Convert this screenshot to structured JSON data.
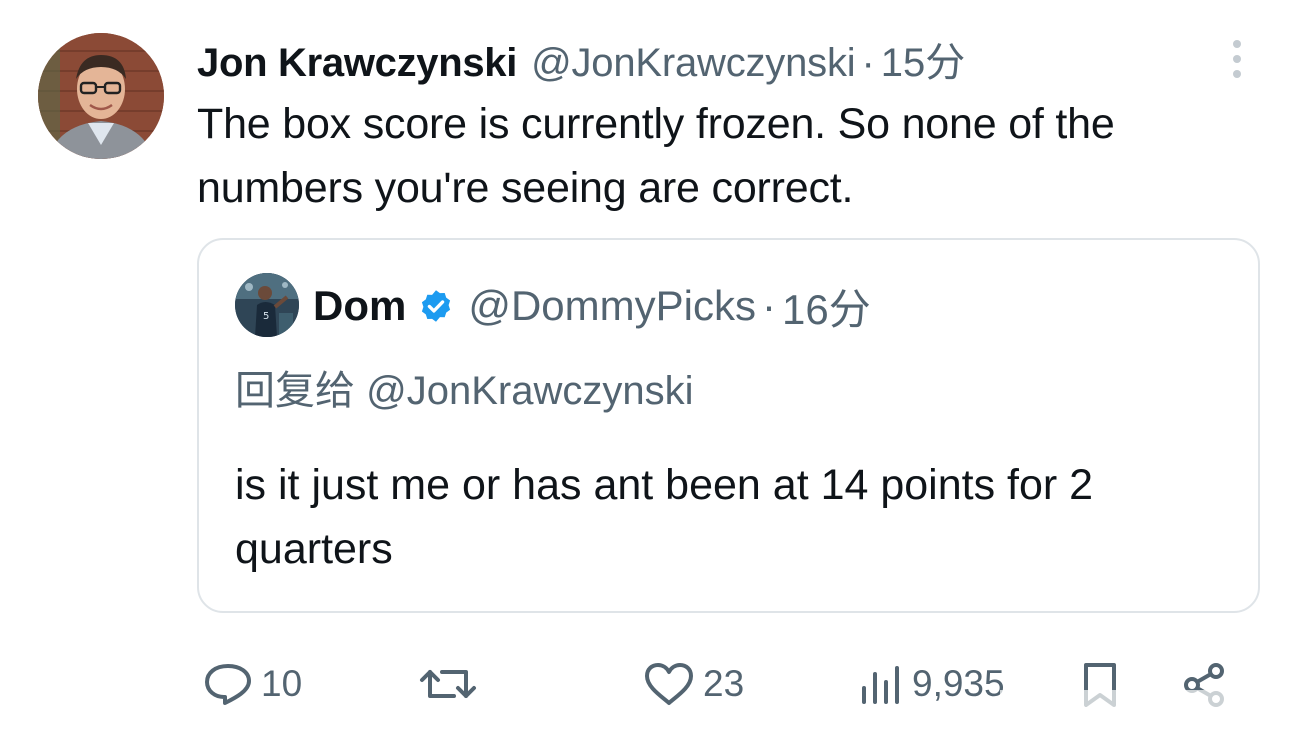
{
  "tweet": {
    "author_name": "Jon Krawczynski",
    "author_handle": "@JonKrawczynski",
    "separator": "·",
    "time": "15分",
    "text": "The box score is currently frozen. So none of the numbers you're seeing are correct.",
    "avatar_icon": "user-avatar"
  },
  "quote": {
    "name": "Dom",
    "verified_icon": "verified-badge-icon",
    "handle": "@DommyPicks",
    "separator": "·",
    "time": "16分",
    "reply_label": "回复给",
    "reply_to": "@JonKrawczynski",
    "text": "is it just me or has ant been at 14 points for 2 quarters"
  },
  "actions": {
    "replies": "10",
    "retweets": "",
    "likes": "23",
    "views": "9,935"
  },
  "colors": {
    "text_primary": "#0f1419",
    "text_secondary": "#536471",
    "verified_blue": "#1d9bf0",
    "border": "#dfe4e8"
  }
}
